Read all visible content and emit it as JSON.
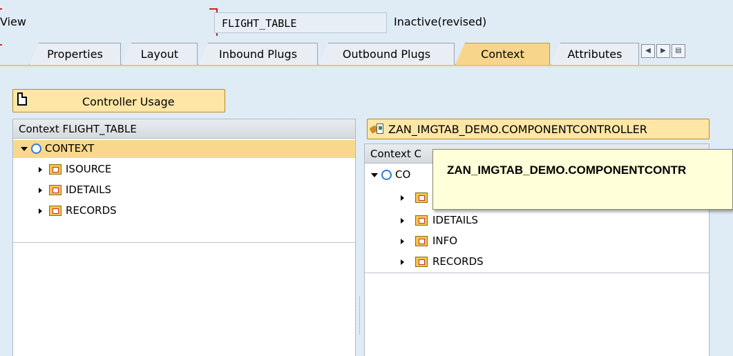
{
  "header": {
    "view_label": "View",
    "view_value": "FLIGHT_TABLE",
    "status": "Inactive(revised)"
  },
  "tabs": [
    {
      "label": "Properties",
      "active": false
    },
    {
      "label": "Layout",
      "active": false
    },
    {
      "label": "Inbound Plugs",
      "active": false
    },
    {
      "label": "Outbound Plugs",
      "active": false
    },
    {
      "label": "Context",
      "active": true
    },
    {
      "label": "Attributes",
      "active": false
    }
  ],
  "toolbar": {
    "controller_usage_label": "Controller Usage"
  },
  "left_panel": {
    "title": "Context FLIGHT_TABLE",
    "root": "CONTEXT",
    "nodes": [
      "ISOURCE",
      "IDETAILS",
      "RECORDS"
    ]
  },
  "right_panel": {
    "controller_button": "ZAN_IMGTAB_DEMO.COMPONENTCONTROLLER",
    "title": "Context C",
    "root": "CO",
    "nodes": [
      "",
      "IDETAILS",
      "INFO",
      "RECORDS"
    ]
  },
  "tooltip": {
    "text": "ZAN_IMGTAB_DEMO.COMPONENTCONTR"
  },
  "colors": {
    "background": "#dfebf5",
    "active_tab": "#f7d58a",
    "selection": "#f8d88c",
    "button": "#fde6a6",
    "tooltip_bg": "#ffffd9"
  }
}
